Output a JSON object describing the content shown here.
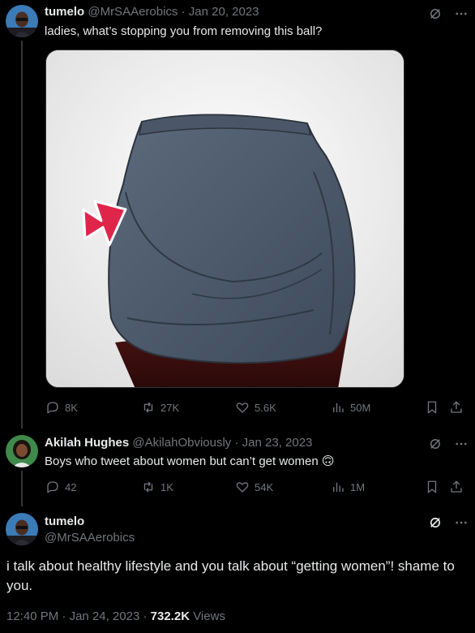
{
  "tweet1": {
    "name": "tumelo",
    "handle": "@MrSAAerobics",
    "sep": "·",
    "date": "Jan 20, 2023",
    "text": "ladies, what’s stopping you from removing this ball?",
    "replies": "8K",
    "retweets": "27K",
    "likes": "5.6K",
    "views": "50M"
  },
  "tweet2": {
    "name": "Akilah Hughes",
    "handle": "@AkilahObviously",
    "sep": "·",
    "date": "Jan 23, 2023",
    "text": "Boys who tweet about women but can’t get women",
    "emoji": "🙃",
    "replies": "42",
    "retweets": "1K",
    "likes": "54K",
    "views": "1M"
  },
  "tweet3": {
    "name": "tumelo",
    "handle": "@MrSAAerobics",
    "text": "i talk about healthy lifestyle and you talk about “getting women”! shame to you.",
    "time": "12:40 PM",
    "date": "Jan 24, 2023",
    "views_count": "732.2K",
    "views_label": "Views",
    "sep": "·"
  },
  "colors": {
    "background": "#000000",
    "text_primary": "#e7e9ea",
    "text_secondary": "#71767b",
    "thread_line": "#333639",
    "skirt": "#4f5d70",
    "arrow": "#e0254a"
  },
  "icons": [
    "grok-icon",
    "more-icon",
    "reply-icon",
    "retweet-icon",
    "like-icon",
    "views-icon",
    "bookmark-icon",
    "share-icon"
  ]
}
